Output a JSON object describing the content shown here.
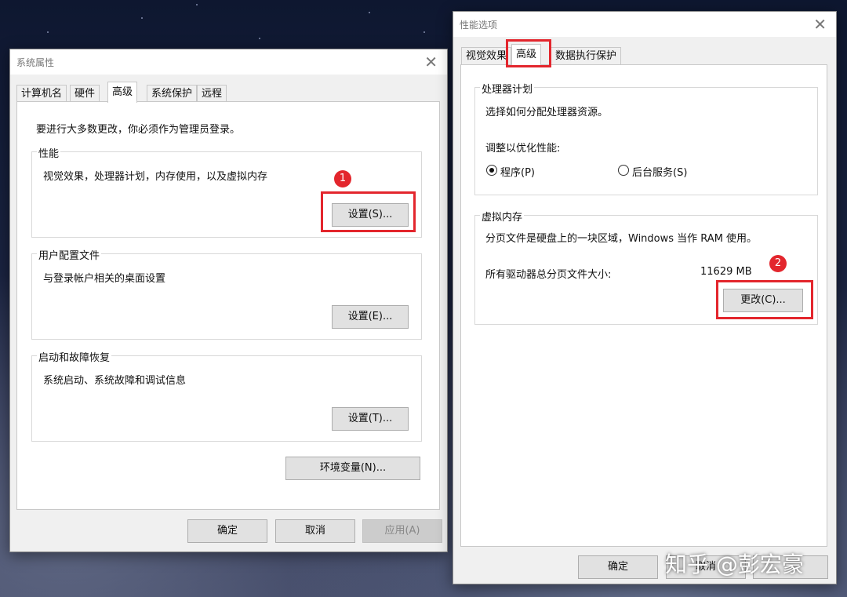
{
  "system_properties": {
    "title": "系统属性",
    "tabs": [
      "计算机名",
      "硬件",
      "高级",
      "系统保护",
      "远程"
    ],
    "admin_note": "要进行大多数更改，你必须作为管理员登录。",
    "performance": {
      "legend": "性能",
      "desc": "视觉效果，处理器计划，内存使用，以及虚拟内存",
      "button": "设置(S)..."
    },
    "user_profiles": {
      "legend": "用户配置文件",
      "desc": "与登录帐户相关的桌面设置",
      "button": "设置(E)..."
    },
    "startup_recovery": {
      "legend": "启动和故障恢复",
      "desc": "系统启动、系统故障和调试信息",
      "button": "设置(T)..."
    },
    "env_button": "环境变量(N)...",
    "ok": "确定",
    "cancel": "取消",
    "apply": "应用(A)"
  },
  "performance_options": {
    "title": "性能选项",
    "tabs": [
      "视觉效果",
      "高级",
      "数据执行保护"
    ],
    "processor": {
      "legend": "处理器计划",
      "desc": "选择如何分配处理器资源。",
      "adjust": "调整以优化性能:",
      "option_programs": "程序(P)",
      "option_services": "后台服务(S)"
    },
    "virtual_memory": {
      "legend": "虚拟内存",
      "desc": "分页文件是硬盘上的一块区域，Windows 当作 RAM 使用。",
      "total_label": "所有驱动器总分页文件大小:",
      "total_value": "11629 MB",
      "button": "更改(C)..."
    },
    "ok": "确定",
    "cancel": "取消"
  },
  "annotations": {
    "badge1": "1",
    "badge2": "2"
  },
  "watermark": "知乎 @彭宏豪",
  "colors": {
    "highlight": "#e3262d"
  },
  "icons": [
    "close-icon",
    "radio-icon"
  ]
}
